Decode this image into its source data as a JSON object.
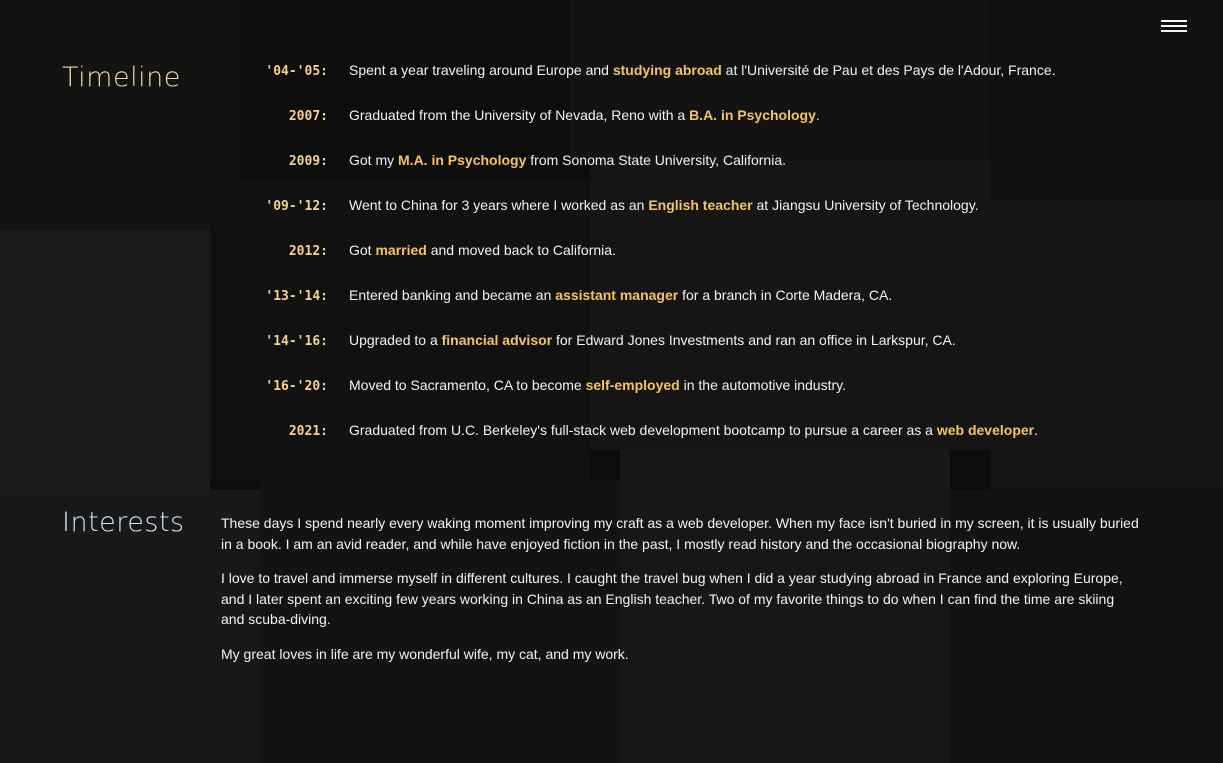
{
  "colors": {
    "heading_timeline": "#f5d9a6",
    "heading_interests": "#cfe3ff",
    "date": "#f7d28f",
    "highlight": "#f6c363",
    "text": "#f2f2f2"
  },
  "nav": {
    "menu_icon": "hamburger-icon"
  },
  "timeline": {
    "heading": "Timeline",
    "items": [
      {
        "date": "'04-'05:",
        "pre": "Spent a year traveling around Europe and ",
        "highlight": "studying abroad",
        "post": " at l'Université de Pau et des Pays de l'Adour, France."
      },
      {
        "date": "2007:",
        "pre": "Graduated from the University of Nevada, Reno with a ",
        "highlight": "B.A. in Psychology",
        "post": "."
      },
      {
        "date": "2009:",
        "pre": "Got my ",
        "highlight": "M.A. in Psychology",
        "post": " from Sonoma State University, California."
      },
      {
        "date": "'09-'12:",
        "pre": "Went to China for 3 years where I worked as an ",
        "highlight": "English teacher",
        "post": " at Jiangsu University of Technology."
      },
      {
        "date": "2012:",
        "pre": "Got ",
        "highlight": "married",
        "post": " and moved back to California."
      },
      {
        "date": "'13-'14:",
        "pre": "Entered banking and became an ",
        "highlight": "assistant manager",
        "post": " for a branch in Corte Madera, CA."
      },
      {
        "date": "'14-'16:",
        "pre": "Upgraded to a ",
        "highlight": "financial advisor",
        "post": " for Edward Jones Investments and ran an office in Larkspur, CA."
      },
      {
        "date": "'16-'20:",
        "pre": "Moved to Sacramento, CA to become ",
        "highlight": "self-employed",
        "post": " in the automotive industry."
      },
      {
        "date": "2021:",
        "pre": "Graduated from U.C. Berkeley's full-stack web development bootcamp to pursue a career as a ",
        "highlight": "web developer",
        "post": "."
      }
    ]
  },
  "interests": {
    "heading": "Interests",
    "paragraphs": [
      "These days I spend nearly every waking moment improving my craft as a web developer. When my face isn't buried in my screen, it is usually buried in a book. I am an avid reader, and while have enjoyed fiction in the past, I mostly read history and the occasional biography now.",
      "I love to travel and immerse myself in different cultures. I caught the travel bug when I did a year studying abroad in France and exploring Europe, and I later spent an exciting few years working in China as an English teacher. Two of my favorite things to do when I can find the time are skiing and scuba-diving.",
      "My great loves in life are my wonderful wife, my cat, and my work."
    ]
  }
}
